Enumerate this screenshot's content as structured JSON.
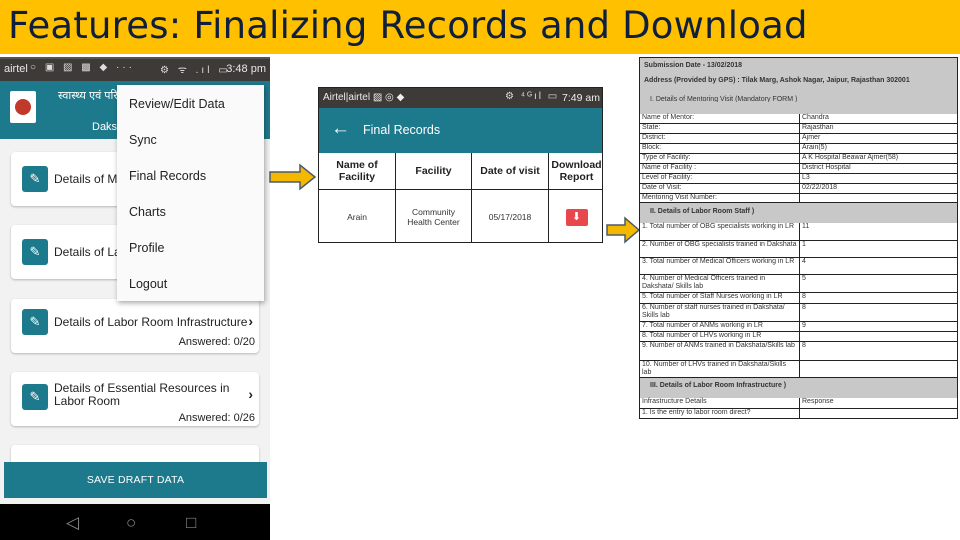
{
  "slide": {
    "title": "Features: Finalizing Records and Download",
    "title_bg": "#ffc000",
    "title_color": "#0f1f3d",
    "accent": "#1d7a8c",
    "arrow_color": "#f5b800"
  },
  "phone1": {
    "status": {
      "carrier": "airtel",
      "left_icons": "○ ▣ ▨ ▩ ◆ ···",
      "right_icons": "⚙ ᯤ .ıl ▭",
      "time": "3:48 pm"
    },
    "header": {
      "hindi_title": "स्वास्थ्य एवं परि",
      "subtitle": "Daksh"
    },
    "cards": [
      {
        "title": "Details of Me",
        "answered": ""
      },
      {
        "title": "Details of La",
        "answered": ""
      },
      {
        "title": "Details of Labor Room Infrastructure",
        "answered": "Answered: 0/20"
      },
      {
        "title": "Details of Essential Resources in Labor Room",
        "answered": "Answered: 0/26"
      }
    ],
    "menu": [
      "Review/Edit Data",
      "Sync",
      "Final Records",
      "Charts",
      "Profile",
      "Logout"
    ],
    "save_button": "SAVE DRAFT DATA",
    "nav": {
      "back": "◁",
      "home": "○",
      "recent": "□"
    }
  },
  "phone2": {
    "status": {
      "carrier": "Airtel|airtel ▨ ◎ ◆",
      "right_icons": "⚙ ⁴ᴳıl ▭",
      "time": "7:49 am"
    },
    "header": {
      "back_icon": "←",
      "title": "Final Records"
    },
    "table": {
      "headers": [
        "Name of Facility",
        "Facility",
        "Date of visit",
        "Download Report"
      ],
      "rows": [
        {
          "name": "Arain",
          "facility": "Community Health Center",
          "date": "05/17/2018",
          "download_icon": "⬇"
        }
      ]
    }
  },
  "document": {
    "submission_date": "Submission Date - 13/02/2018",
    "address": "Address (Provided by GPS) : Tilak Marg, Ashok Nagar, Jaipur, Rajasthan 302001",
    "section1_title": "I. Details of Mentoring Visit (Mandatory FORM )",
    "section1_rows": [
      {
        "label": "Name of Mentor:",
        "value": "Chandra"
      },
      {
        "label": "State:",
        "value": "Rajasthan"
      },
      {
        "label": "District:",
        "value": "Ajmer"
      },
      {
        "label": "Block:",
        "value": "Arain(5)"
      },
      {
        "label": "Type of Facility:",
        "value": "A K Hospital Beawar Ajmer(58)"
      },
      {
        "label": "Name of Facility :",
        "value": "District Hospital"
      },
      {
        "label": "Level of Facility:",
        "value": "L3"
      },
      {
        "label": "Date of Visit:",
        "value": "02/22/2018"
      },
      {
        "label": "Mentoring Visit Number:",
        "value": ""
      }
    ],
    "section2_title": "II. Details of Labor Room Staff )",
    "section2_rows": [
      {
        "label": "1. Total number of OBG specialists working in LR",
        "value": "11"
      },
      {
        "label": "2. Number of OBG specialists trained in Dakshata",
        "value": "1"
      },
      {
        "label": "3. Total number of Medical Officers working in LR",
        "value": "4"
      },
      {
        "label": "4. Number of Medical Officers trained in Dakshata/ Skills lab",
        "value": "5"
      },
      {
        "label": "5. Total number of Staff Nurses working in LR",
        "value": "8"
      },
      {
        "label": "6. Number of staff nurses trained in Dakshata/ Skills lab",
        "value": "8"
      },
      {
        "label": "7. Total number of ANMs working in LR",
        "value": "9"
      },
      {
        "label": "8. Total number of LHVs working in LR",
        "value": ""
      },
      {
        "label": "9. Number of ANMs trained in Dakshata/Skills lab",
        "value": "8"
      },
      {
        "label": "10. Number of LHVs trained in Dakshata/Skills lab",
        "value": ""
      }
    ],
    "section3_title": "III. Details of Labor Room Infrastructure )",
    "section3_rows": [
      {
        "label": "Infrastructure Details",
        "value": "Response"
      },
      {
        "label": "1. Is the entry to labor room direct?",
        "value": ""
      }
    ]
  }
}
